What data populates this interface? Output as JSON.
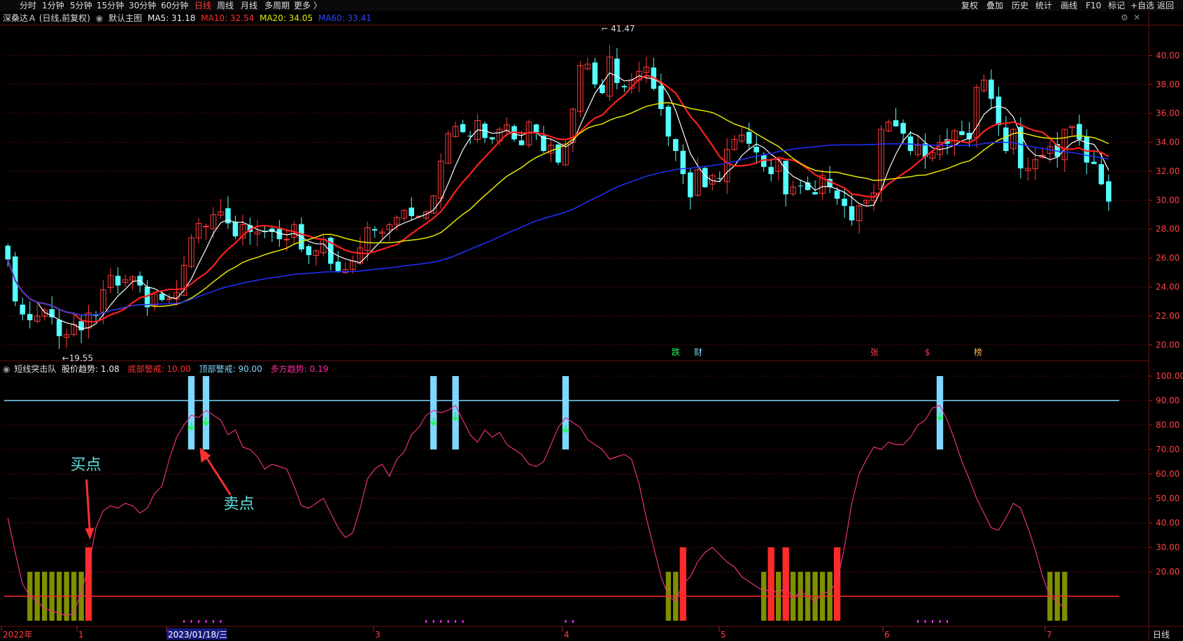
{
  "toolbar": {
    "left": [
      "分时",
      "1分钟",
      "5分钟",
      "15分钟",
      "30分钟",
      "60分钟",
      "日线",
      "周线",
      "月线",
      "多周期",
      "更多 〉"
    ],
    "active": "日线",
    "right": [
      "复权",
      "叠加",
      "历史",
      "统计",
      "画线",
      "F10",
      "标记",
      "+自选",
      "返回"
    ]
  },
  "main_info": {
    "stock": "深桑达Ａ (日线,前复权)",
    "template": "默认主图",
    "ma5": "MA5: 31.18",
    "ma10": "MA10: 32.54",
    "ma20": "MA20: 34.05",
    "ma60": "MA60: 33.41"
  },
  "sub_info": {
    "name": "短线突击队",
    "trend": "股价趋势: 1.08",
    "bottom": "底部警戒: 10.00",
    "top": "顶部警戒: 90.00",
    "multi": "多方趋势: 0.19"
  },
  "colors": {
    "up": "#ff3b3b",
    "down": "#54ffff",
    "ma5": "#ffffff",
    "ma10": "#ff2020",
    "ma20": "#e8e800",
    "ma60": "#2030ff",
    "trend": "#e8307a",
    "warn_top": "#7fd8ff",
    "warn_bottom": "#ff2a2a",
    "olive": "#7f8f00"
  },
  "bottom_axis": {
    "labels": [
      "2022年",
      "1",
      "2023/01/18/三",
      "3",
      "4",
      "5",
      "6",
      "7"
    ],
    "right_label": "日线"
  },
  "annotations": {
    "high": "41.47",
    "low": "←19.55",
    "buy": "买点",
    "sell": "卖点",
    "events": [
      "跌",
      "财",
      "张",
      "$",
      "榜"
    ]
  },
  "chart_data": [
    {
      "type": "candlestick",
      "ylim": [
        19,
        42
      ],
      "yticks": [
        "20.00",
        "22.00",
        "24.00",
        "26.00",
        "28.00",
        "30.00",
        "32.00",
        "34.00",
        "36.00",
        "38.00",
        "40.00"
      ],
      "close": [
        25.9,
        23.0,
        22.1,
        21.7,
        22.0,
        22.4,
        21.9,
        20.6,
        20.7,
        21.4,
        21.0,
        22.2,
        22.0,
        23.8,
        24.8,
        24.1,
        24.5,
        24.7,
        24.1,
        22.6,
        23.5,
        23.1,
        23.2,
        23.6,
        25.5,
        27.4,
        28.4,
        28.2,
        29.0,
        29.2,
        28.4,
        27.5,
        28.3,
        27.8,
        27.8,
        27.8,
        27.8,
        27.3,
        27.3,
        28.3,
        26.6,
        26.2,
        26.5,
        27.3,
        25.6,
        25.1,
        25.2,
        25.8,
        26.7,
        28.1,
        27.9,
        27.8,
        28.3,
        28.8,
        29.3,
        28.9,
        28.9,
        29.2,
        30.3,
        32.7,
        34.6,
        35.1,
        34.7,
        34.4,
        35.5,
        34.3,
        34.2,
        34.9,
        35.2,
        34.2,
        33.8,
        35.4,
        34.7,
        33.4,
        33.8,
        32.6,
        33.9,
        36.3,
        39.3,
        39.4,
        38.0,
        37.4,
        39.9,
        38.1,
        37.8,
        38.3,
        38.9,
        39.2,
        37.7,
        36.3,
        34.4,
        33.4,
        31.8,
        30.2,
        32.1,
        30.9,
        31.7,
        31.5,
        33.5,
        34.2,
        34.5,
        33.9,
        33.3,
        32.3,
        31.8,
        32.8,
        30.4,
        30.9,
        31.0,
        30.7,
        30.4,
        31.7,
        30.9,
        30.1,
        29.6,
        28.6,
        29.6,
        30.0,
        30.5,
        34.9,
        35.4,
        35.1,
        34.6,
        33.4,
        33.8,
        33.0,
        33.3,
        34.0,
        33.9,
        34.8,
        34.5,
        34.2,
        37.8,
        38.3,
        37.0,
        35.2,
        33.4,
        34.9,
        32.2,
        32.2,
        32.8,
        33.1,
        33.7,
        33.0,
        34.9,
        35.1,
        34.2,
        32.6,
        32.5,
        31.1,
        29.9
      ]
    },
    {
      "type": "line",
      "name": "股价趋势",
      "ylim": [
        0,
        100
      ],
      "yticks": [
        "20.00",
        "30.00",
        "40.00",
        "50.00",
        "60.00",
        "70.00",
        "80.00",
        "90.00",
        "100.00"
      ],
      "top_warning": 90,
      "bottom_warning": 10,
      "values": [
        42,
        28,
        15,
        10,
        8,
        5,
        4,
        3,
        2,
        3,
        12,
        22,
        38,
        45,
        47,
        46,
        48,
        47,
        44,
        46,
        52,
        55,
        66,
        75,
        80,
        84,
        83,
        86,
        84,
        82,
        76,
        78,
        71,
        70,
        67,
        62,
        64,
        63,
        62,
        55,
        47,
        46,
        48,
        50,
        44,
        38,
        34,
        36,
        46,
        58,
        62,
        64,
        59,
        66,
        69,
        76,
        79,
        84,
        86,
        85,
        86,
        88,
        82,
        76,
        73,
        78,
        75,
        77,
        72,
        70,
        68,
        64,
        63,
        65,
        72,
        79,
        83,
        81,
        79,
        74,
        72,
        70,
        66,
        67,
        68,
        66,
        56,
        42,
        30,
        18,
        10,
        8,
        15,
        18,
        24,
        28,
        30,
        27,
        24,
        22,
        18,
        16,
        14,
        12,
        13,
        11,
        14,
        9,
        12,
        10,
        8,
        11,
        12,
        16,
        30,
        48,
        60,
        66,
        71,
        70,
        73,
        72,
        72,
        75,
        80,
        82,
        87,
        88,
        82,
        74,
        65,
        58,
        50,
        44,
        38,
        37,
        42,
        48,
        46,
        38,
        29,
        18,
        10,
        8,
        5
      ]
    }
  ]
}
